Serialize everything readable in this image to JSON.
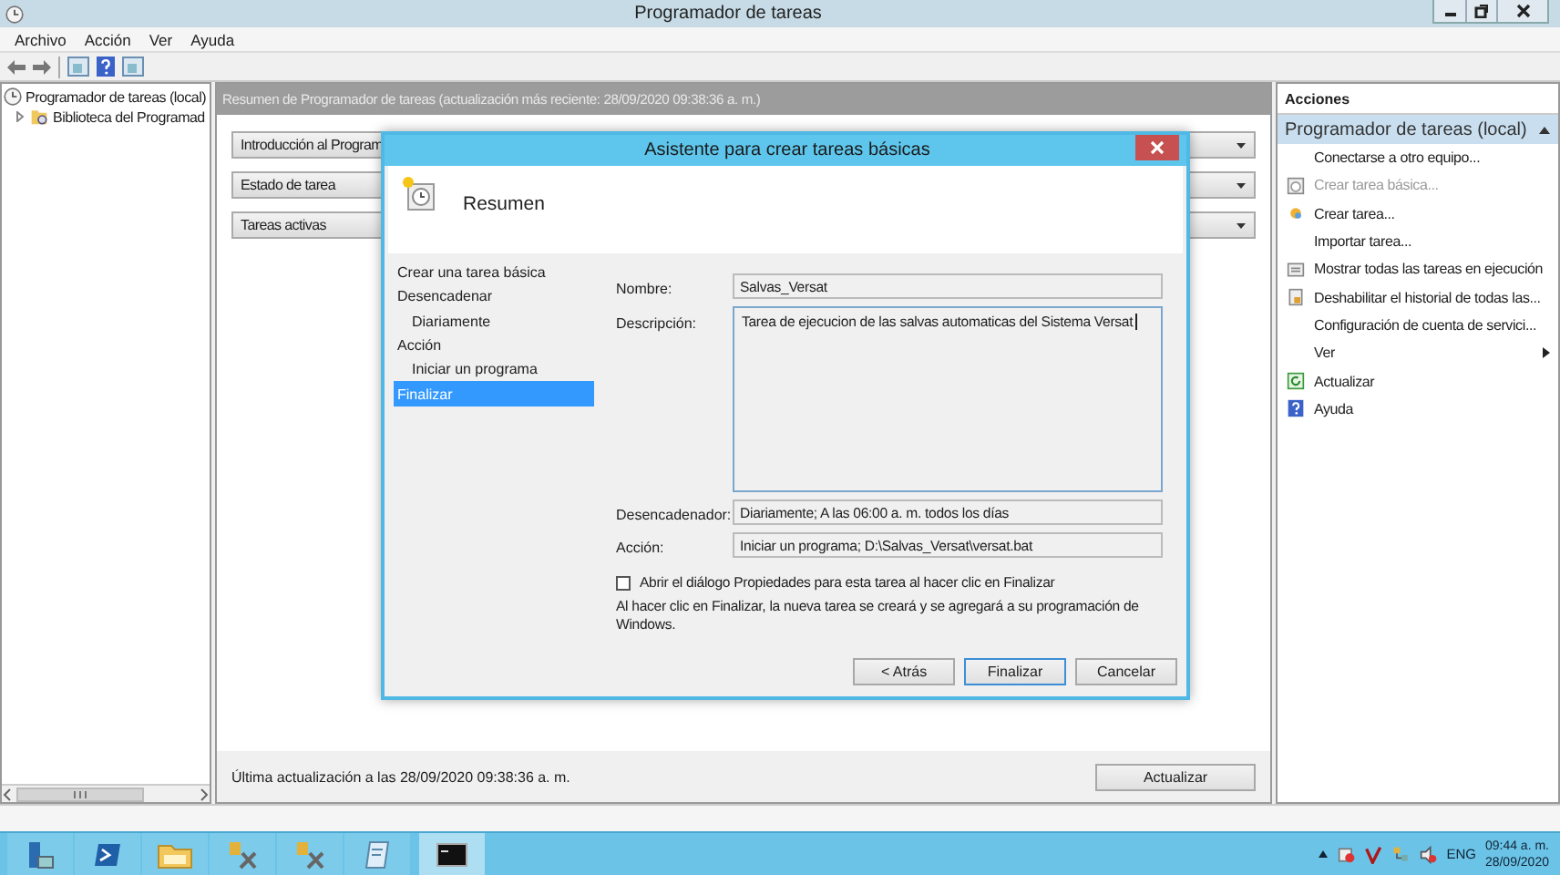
{
  "window": {
    "title": "Programador de tareas"
  },
  "menu": [
    "Archivo",
    "Acción",
    "Ver",
    "Ayuda"
  ],
  "tree": [
    {
      "label": "Programador de tareas (local)",
      "children": [
        {
          "label": "Biblioteca del Programad",
          "expanded": false
        }
      ]
    }
  ],
  "summary": {
    "header": "Resumen de Programador de tareas (actualización más reciente: 28/09/2020 09:38:36 a. m.)",
    "sections": [
      "Introducción al Program",
      "Estado de tarea",
      "Tareas activas"
    ],
    "status": "Última actualización a las 28/09/2020 09:38:36 a. m.",
    "refresh_button": "Actualizar"
  },
  "dialog": {
    "title": "Asistente para crear tareas básicas",
    "heading": "Resumen",
    "steps": [
      {
        "label": "Crear una tarea básica",
        "selected": false
      },
      {
        "label": "Desencadenar",
        "selected": false,
        "children": [
          {
            "label": "Diariamente",
            "selected": false
          }
        ]
      },
      {
        "label": "Acción",
        "selected": false,
        "children": [
          {
            "label": "Iniciar un programa",
            "selected": false
          }
        ]
      },
      {
        "label": "Finalizar",
        "selected": true
      }
    ],
    "fields": [
      {
        "label": "Nombre:",
        "value": "Salvas_Versat",
        "kind": "line"
      },
      {
        "label": "Descripción:",
        "value": "Tarea de ejecucion de las salvas automaticas del Sistema Versat",
        "kind": "multiline"
      },
      {
        "label": "Desencadenador:",
        "value": "Diariamente; A las 06:00 a. m. todos los días",
        "kind": "line"
      },
      {
        "label": "Acción:",
        "value": "Iniciar un programa; D:\\Salvas_Versat\\versat.bat",
        "kind": "line"
      }
    ],
    "open_properties": {
      "label": "Abrir el diálogo Propiedades para esta tarea al hacer clic en Finalizar",
      "checked": false
    },
    "note": "Al hacer clic en Finalizar, la nueva tarea se creará y se agregará a su programación de Windows.",
    "buttons": [
      {
        "label": "< Atrás",
        "default": false
      },
      {
        "label": "Finalizar",
        "default": true
      },
      {
        "label": "Cancelar",
        "default": false
      }
    ]
  },
  "actions": {
    "title": "Acciones",
    "group": {
      "label": "Programador de tareas (local)",
      "expanded": true
    },
    "items": [
      {
        "label": "Conectarse a otro equipo...",
        "disabled": false
      },
      {
        "label": "Crear tarea básica...",
        "disabled": true
      },
      {
        "label": "Crear tarea...",
        "disabled": false
      },
      {
        "label": "Importar tarea...",
        "disabled": false
      },
      {
        "label": "Mostrar todas las tareas en ejecución",
        "disabled": false
      },
      {
        "label": "Deshabilitar el historial de todas las...",
        "disabled": false
      },
      {
        "label": "Configuración de cuenta de servici...",
        "disabled": false
      },
      {
        "label": "Ver",
        "disabled": false,
        "submenu": true
      },
      {
        "label": "Actualizar",
        "disabled": false
      },
      {
        "label": "Ayuda",
        "disabled": false
      }
    ]
  },
  "taskbar": {
    "apps": [
      {
        "selected": false
      },
      {
        "selected": false
      },
      {
        "selected": false
      },
      {
        "selected": false
      },
      {
        "selected": false
      },
      {
        "selected": false
      },
      {
        "selected": true
      }
    ],
    "language": "ENG",
    "time": "09:44 a. m.",
    "date": "28/09/2020"
  }
}
